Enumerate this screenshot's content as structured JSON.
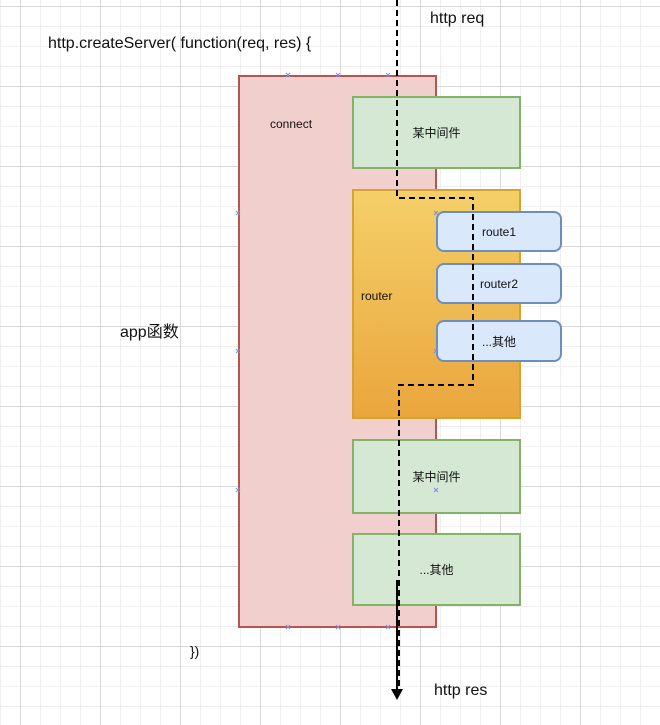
{
  "texts": {
    "http_req": "http req",
    "http_res": "http res",
    "create_server": "http.createServer( function(req, res) {",
    "closing": "})",
    "app_label": "app函数",
    "connect_label": "connect",
    "router_label": "router"
  },
  "middleware": {
    "top": "某中间件",
    "middle": "某中间件",
    "bottom": "...其他"
  },
  "routes": [
    "route1",
    "router2",
    "...其他"
  ],
  "colors": {
    "connect_fill": "#f1cfcd",
    "connect_stroke": "#b85450",
    "middleware_fill": "#d5e8d4",
    "middleware_stroke": "#82b366",
    "router_fill": "#f0b84c",
    "route_fill": "#dae8fc",
    "route_stroke": "#6c8ebf",
    "flow_line": "#000000"
  }
}
